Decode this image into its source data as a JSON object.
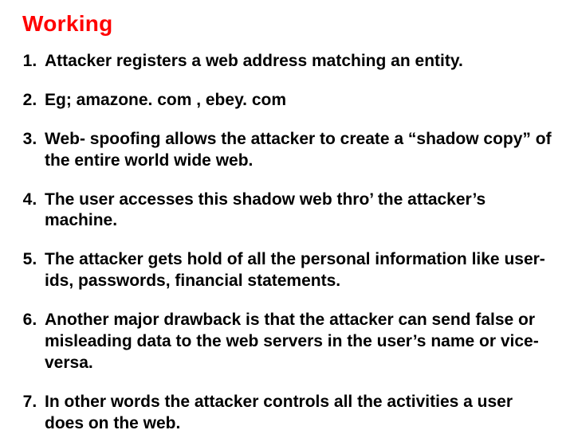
{
  "heading": "Working",
  "items": [
    "Attacker registers a web address matching an entity.",
    "Eg; amazone. com , ebey. com",
    "Web- spoofing allows the attacker to create a “shadow copy” of the entire world wide web.",
    "The user accesses this shadow web thro’ the attacker’s machine.",
    "The attacker gets hold of all the personal information like user-ids, passwords, financial statements.",
    "Another major drawback is that the attacker can send false or misleading data to the web servers in the user’s name or vice-versa.",
    "In other words the attacker controls all the activities a user does on the web."
  ]
}
